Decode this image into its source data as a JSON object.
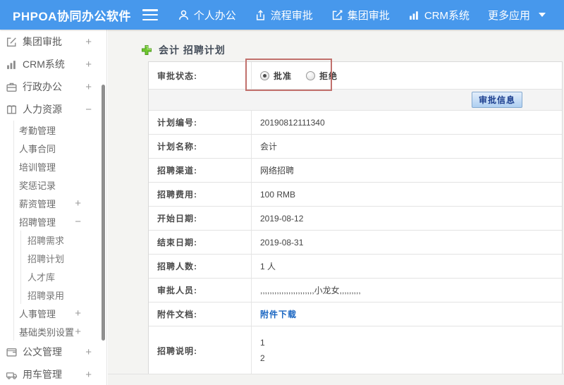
{
  "topbar": {
    "brand": "PHPOA协同办公软件",
    "nav": [
      {
        "label": "个人办公",
        "icon": "person-icon"
      },
      {
        "label": "流程审批",
        "icon": "flow-icon"
      },
      {
        "label": "集团审批",
        "icon": "edit-icon"
      },
      {
        "label": "CRM系统",
        "icon": "bar-chart-icon"
      },
      {
        "label": "更多应用",
        "icon": "caret-down-icon"
      }
    ]
  },
  "sidebar": {
    "items": [
      {
        "label": "集团审批",
        "icon": "edit-icon",
        "toggle": "+"
      },
      {
        "label": "CRM系统",
        "icon": "bar-chart-icon",
        "toggle": "+"
      },
      {
        "label": "行政办公",
        "icon": "briefcase-icon",
        "toggle": "+"
      },
      {
        "label": "人力资源",
        "icon": "book-icon",
        "toggle": "−"
      },
      {
        "label": "考勤管理"
      },
      {
        "label": "人事合同"
      },
      {
        "label": "培训管理"
      },
      {
        "label": "奖惩记录"
      },
      {
        "label": "薪资管理",
        "toggle": "+"
      },
      {
        "label": "招聘管理",
        "toggle": "−"
      },
      {
        "label": "招聘需求"
      },
      {
        "label": "招聘计划"
      },
      {
        "label": "人才库"
      },
      {
        "label": "招聘录用"
      },
      {
        "label": "人事管理",
        "toggle": "+"
      },
      {
        "label": "基础类别设置",
        "toggle": "+"
      },
      {
        "label": "公文管理",
        "icon": "document-icon",
        "toggle": "+"
      },
      {
        "label": "用车管理",
        "icon": "car-icon",
        "toggle": "+"
      }
    ]
  },
  "main": {
    "title": "会计 招聘计划",
    "status_row": {
      "label": "审批状态:",
      "options": [
        {
          "label": "批准",
          "checked": true
        },
        {
          "label": "拒绝",
          "checked": false
        }
      ]
    },
    "approve_button": "审批信息",
    "rows": [
      {
        "label": "计划编号:",
        "value": "20190812111340"
      },
      {
        "label": "计划名称:",
        "value": "会计"
      },
      {
        "label": "招聘渠道:",
        "value": "网络招聘"
      },
      {
        "label": "招聘费用:",
        "value": "100 RMB"
      },
      {
        "label": "开始日期:",
        "value": "2019-08-12"
      },
      {
        "label": "结束日期:",
        "value": "2019-08-31"
      },
      {
        "label": "招聘人数:",
        "value": "1 人"
      },
      {
        "label": "审批人员:",
        "value": ",,,,,,,,,,,,,,,,,,,,,,,小龙女,,,,,,,,,"
      },
      {
        "label": "附件文档:",
        "value": "附件下载"
      },
      {
        "label": "招聘说明:"
      }
    ],
    "description_lines": {
      "line1": "1",
      "line2": "2"
    }
  },
  "colors": {
    "topbar_blue": "#4798ec",
    "highlight_red": "#c1706c",
    "link_blue": "#1a66c2",
    "plus_green": "#6fc82f",
    "button_face": "#aecff1"
  }
}
